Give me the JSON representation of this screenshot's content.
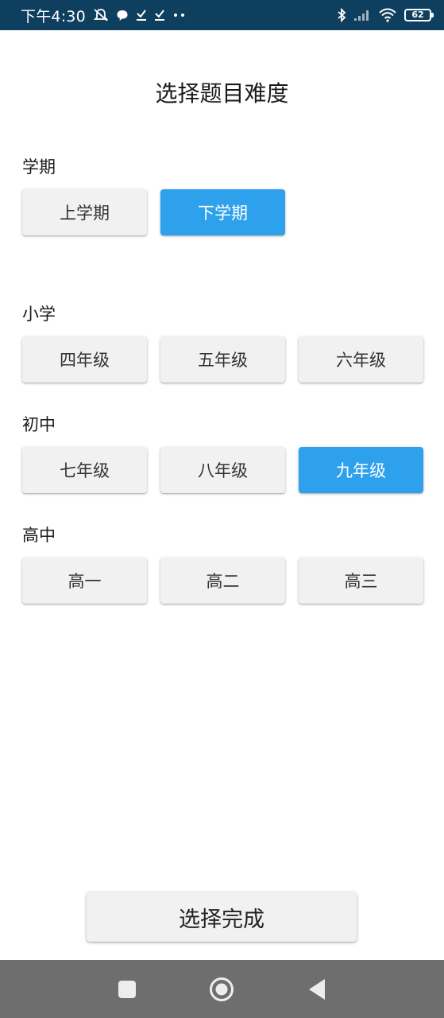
{
  "status_bar": {
    "time": "下午4:30",
    "battery": "62",
    "left_icons": [
      "mute-icon",
      "chat-bubble-icon",
      "download-done-icon",
      "download-done-icon",
      "more-dots-icon"
    ],
    "right_icons": [
      "bluetooth-icon",
      "signal-icon",
      "wifi-icon",
      "battery-icon"
    ]
  },
  "title": "选择题目难度",
  "semester": {
    "label": "学期",
    "options": [
      "上学期",
      "下学期"
    ],
    "selected": "下学期"
  },
  "primary": {
    "label": "小学",
    "options": [
      "四年级",
      "五年级",
      "六年级"
    ]
  },
  "middle": {
    "label": "初中",
    "options": [
      "七年级",
      "八年级",
      "九年级"
    ],
    "selected": "九年级"
  },
  "high": {
    "label": "高中",
    "options": [
      "高一",
      "高二",
      "高三"
    ]
  },
  "done_button": "选择完成",
  "nav_bar": {
    "icons": [
      "recent-apps-icon",
      "home-icon",
      "back-icon"
    ]
  },
  "colors": {
    "accent": "#2ea1ec",
    "status_bar": "#0f3f5f",
    "nav_bar": "#6e6e6e",
    "button_bg": "#f1f1f1"
  }
}
